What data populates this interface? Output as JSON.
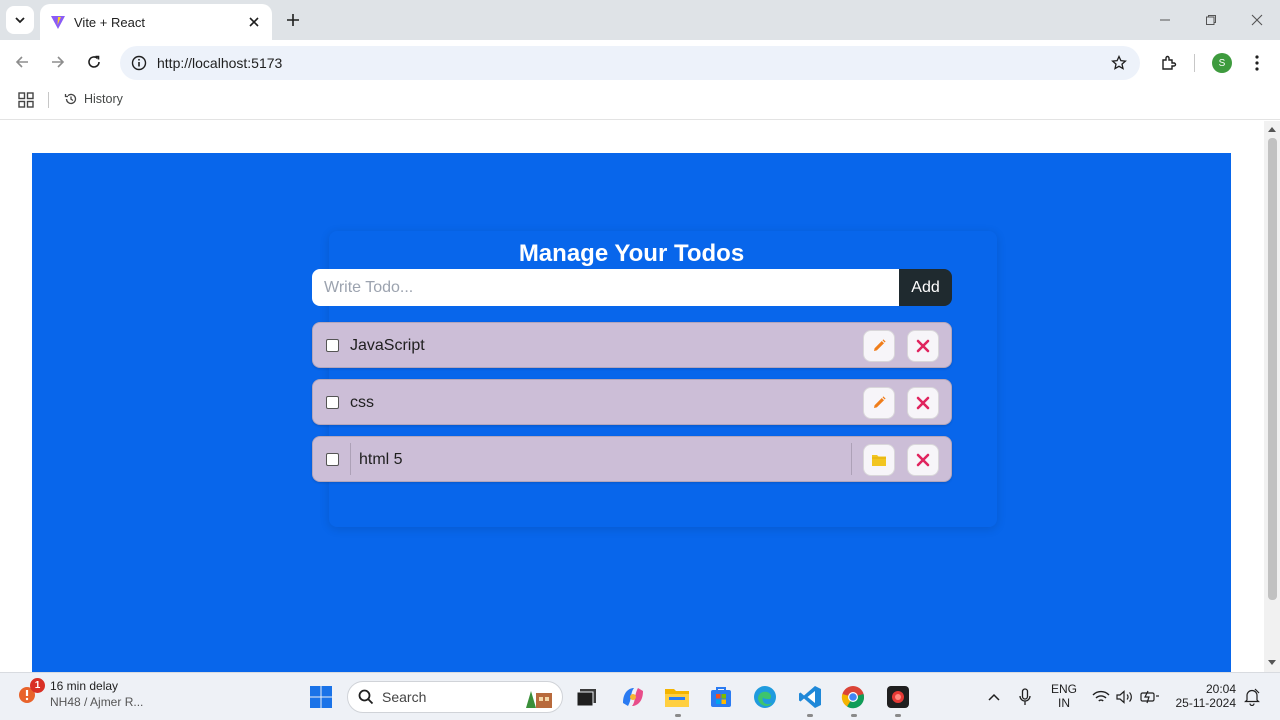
{
  "browser": {
    "tab_title": "Vite + React",
    "url": "http://localhost:5173",
    "bookmark_history": "History",
    "profile_initial": "S"
  },
  "app": {
    "title": "Manage Your Todos",
    "input_placeholder": "Write Todo...",
    "add_label": "Add",
    "todos": [
      {
        "text": "JavaScript",
        "completed": false,
        "editing": false
      },
      {
        "text": "css",
        "completed": false,
        "editing": false
      },
      {
        "text": "html 5",
        "completed": false,
        "editing": true
      }
    ]
  },
  "taskbar": {
    "weather_badge": "1",
    "weather_line1": "16 min delay",
    "weather_line2": "NH48 / Ajmer R...",
    "search_label": "Search",
    "lang_line1": "ENG",
    "lang_line2": "IN",
    "time": "20:04",
    "date": "25-11-2024"
  },
  "colors": {
    "app_background": "#0866eb",
    "todo_item": "#ccbed7",
    "add_button": "#1f2a2f",
    "edit_icon": "#f07d1a",
    "delete_icon": "#e0245e",
    "save_icon": "#f2c521"
  }
}
